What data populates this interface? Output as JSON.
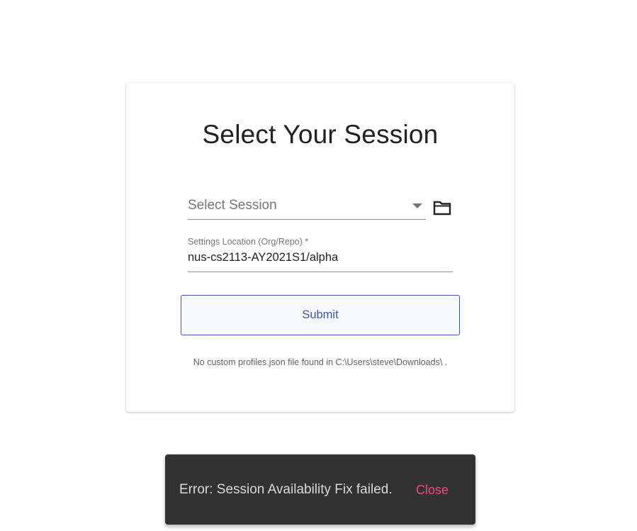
{
  "page": {
    "title": "Select Your Session"
  },
  "session_select": {
    "placeholder": "Select Session",
    "folder_icon": "folder-icon"
  },
  "settings_location": {
    "label": "Settings Location (Org/Repo) *",
    "value": "nus-cs2113-AY2021S1/alpha"
  },
  "submit": {
    "label": "Submit"
  },
  "note": {
    "text": "No custom profiles.json file found in C:\\Users\\steve\\Downloads\\ ."
  },
  "snackbar": {
    "message": "Error: Session Availability Fix failed.",
    "action_label": "Close"
  },
  "colors": {
    "primary": "#3f51b5",
    "accent": "#ff4081",
    "snackbar_bg": "#323232"
  }
}
